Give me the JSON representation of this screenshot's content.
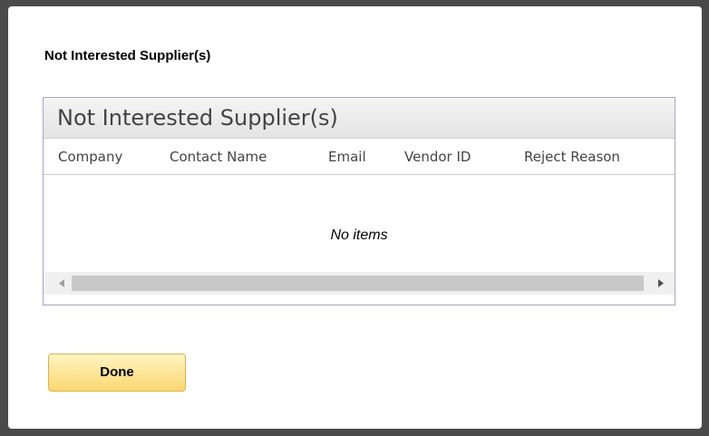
{
  "dialog": {
    "title": "Not Interested Supplier(s)"
  },
  "grid": {
    "title": "Not Interested Supplier(s)",
    "columns": [
      "Company",
      "Contact Name",
      "Email",
      "Vendor ID",
      "Reject Reason"
    ],
    "empty_message": "No items"
  },
  "buttons": {
    "done_label": "Done"
  },
  "colors": {
    "grid_border": "#a9a3c4",
    "button_gradient_top": "#fff4c2",
    "button_gradient_bottom": "#fbd770",
    "scroll_thumb": "#c8c8c8"
  },
  "icons": {
    "scroll_left": "chevron-left-icon",
    "scroll_right": "chevron-right-icon"
  }
}
